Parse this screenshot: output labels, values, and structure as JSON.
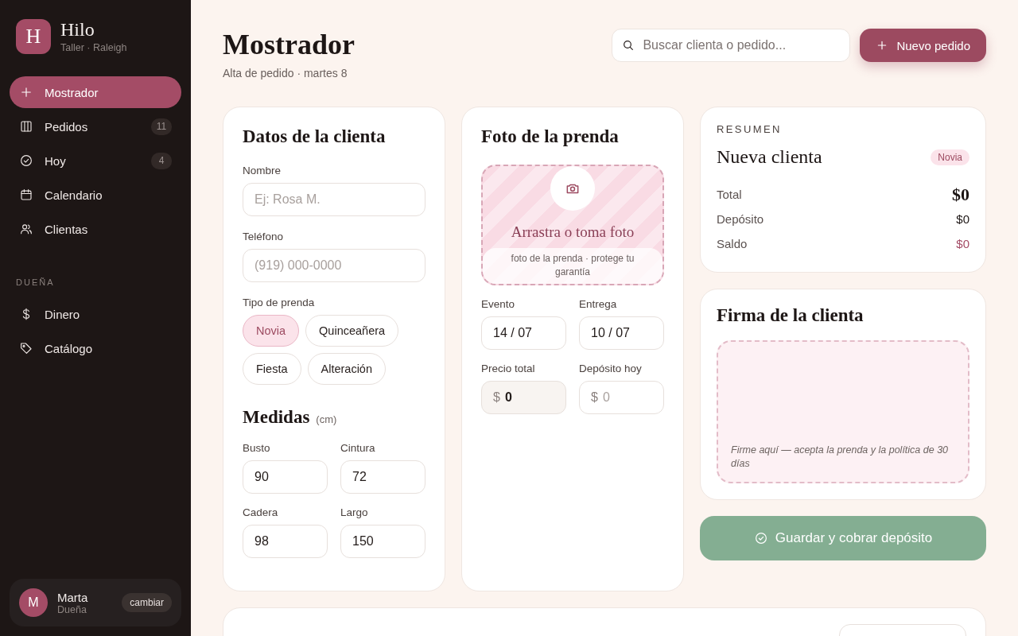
{
  "brand": {
    "initial": "H",
    "name": "Hilo",
    "subtitle": "Taller · Raleigh"
  },
  "nav": [
    {
      "label": "Mostrador",
      "selected": true
    },
    {
      "label": "Pedidos",
      "count": "11",
      "selected": false
    },
    {
      "label": "Hoy",
      "count": "4",
      "selected": false
    },
    {
      "label": "Calendario",
      "selected": false
    },
    {
      "label": "Clientas",
      "selected": false
    }
  ],
  "owner_section": {
    "label": "DUEÑA",
    "items": [
      {
        "label": "Dinero",
        "selected": false
      },
      {
        "label": "Catálogo",
        "selected": false
      }
    ]
  },
  "user": {
    "initial": "M",
    "name": "Marta",
    "role": "Dueña",
    "action": "cambiar"
  },
  "header": {
    "title": "Mostrador",
    "subtitle": "Alta de pedido · martes 8",
    "search": {
      "placeholder": "Buscar clienta o pedido..."
    },
    "new_button": "Nuevo pedido"
  },
  "client_card": {
    "title": "Datos de la clienta",
    "fields": [
      {
        "label": "Nombre",
        "placeholder": "Ej: Rosa M."
      },
      {
        "label": "Teléfono",
        "placeholder": "(919) 000-0000"
      }
    ],
    "garment_label": "Tipo de prenda",
    "garment_types": [
      {
        "label": "Novia",
        "selected": true
      },
      {
        "label": "Quinceañera",
        "selected": false
      },
      {
        "label": "Fiesta",
        "selected": false
      },
      {
        "label": "Alteración",
        "selected": false
      }
    ],
    "measures_title": "Medidas",
    "measures_unit": "(cm)",
    "measures": [
      {
        "label": "Busto",
        "value": "90"
      },
      {
        "label": "Cintura",
        "value": "72"
      },
      {
        "label": "Cadera",
        "value": "98"
      },
      {
        "label": "Largo",
        "value": "150"
      }
    ]
  },
  "photo_card": {
    "title": "Foto de la prenda",
    "drop_title": "Arrastra o toma foto",
    "drop_hint": "foto de la prenda · protege tu garantía",
    "dates": [
      {
        "label": "Evento",
        "value": "14 / 07"
      },
      {
        "label": "Entrega",
        "value": "10 / 07"
      }
    ],
    "prices": [
      {
        "label": "Precio total",
        "prefix": "$",
        "value": "0",
        "readonly": true
      },
      {
        "label": "Depósito hoy",
        "prefix": "$",
        "placeholder": "0",
        "readonly": false
      }
    ]
  },
  "summary": {
    "label": "RESUMEN",
    "client": "Nueva clienta",
    "tag": "Novia",
    "rows": [
      {
        "kind": "total",
        "label": "Total",
        "value": "$0"
      },
      {
        "kind": "plain",
        "label": "Depósito",
        "value": "$0"
      },
      {
        "kind": "due",
        "label": "Saldo",
        "value": "$0"
      }
    ]
  },
  "signature": {
    "title": "Firma de la clienta",
    "hint": "Firme aquí — acepta la prenda y la política de 30 días"
  },
  "save_button": "Guardar y cobrar depósito"
}
